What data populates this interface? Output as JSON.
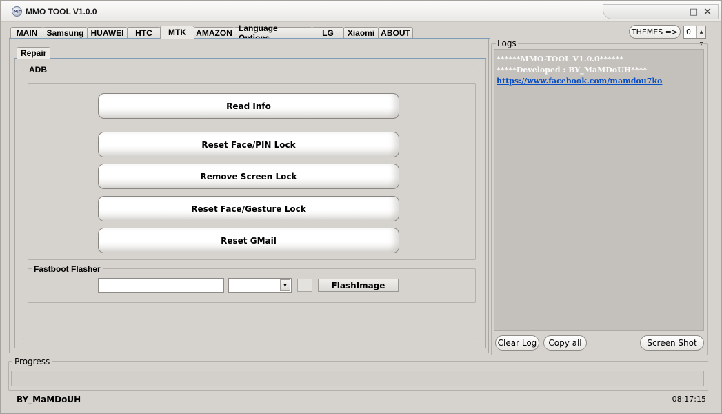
{
  "window": {
    "title": "MMO TOOL V1.0.0",
    "icon_label": "Mr",
    "controls": [
      "minimize-icon",
      "maximize-icon",
      "close-icon"
    ]
  },
  "tabs": [
    {
      "label": "MAIN"
    },
    {
      "label": "Samsung"
    },
    {
      "label": "HUAWEI"
    },
    {
      "label": "HTC"
    },
    {
      "label": "MTK",
      "active": true
    },
    {
      "label": "AMAZON"
    },
    {
      "label": "Language Options"
    },
    {
      "label": "LG"
    },
    {
      "label": "Xiaomi"
    },
    {
      "label": "ABOUT"
    }
  ],
  "themes": {
    "button_label": "THEMES =>",
    "spinner_value": "0"
  },
  "subtab": {
    "label": "Repair"
  },
  "adb": {
    "title": "ADB",
    "buttons": [
      {
        "label": "Read Info"
      },
      {
        "label": "Reset Face/PIN Lock"
      },
      {
        "label": "Remove Screen Lock"
      },
      {
        "label": "Reset Face/Gesture Lock"
      },
      {
        "label": "Reset GMail"
      }
    ]
  },
  "fastboot": {
    "title": "Fastboot Flasher",
    "file_value": "",
    "select_value": "",
    "flash_label": "FlashImage"
  },
  "logs": {
    "title": "Logs",
    "lines": [
      "******MMO-TOOL V1.0.0******",
      "*****Developed : BY_MaMDoUH****"
    ],
    "link": "https://www.facebook.com/mamdou7ko",
    "clear_label": "Clear Log",
    "copy_label": "Copy all",
    "screenshot_label": "Screen Shot"
  },
  "progress": {
    "title": "Progress",
    "value": 0
  },
  "status": {
    "left": "BY_MaMDoUH",
    "right": "08:17:15"
  },
  "colors": {
    "log_text": "#fafafa",
    "log_link": "#0b4fc4",
    "tab_underline": "#7f9db9"
  }
}
